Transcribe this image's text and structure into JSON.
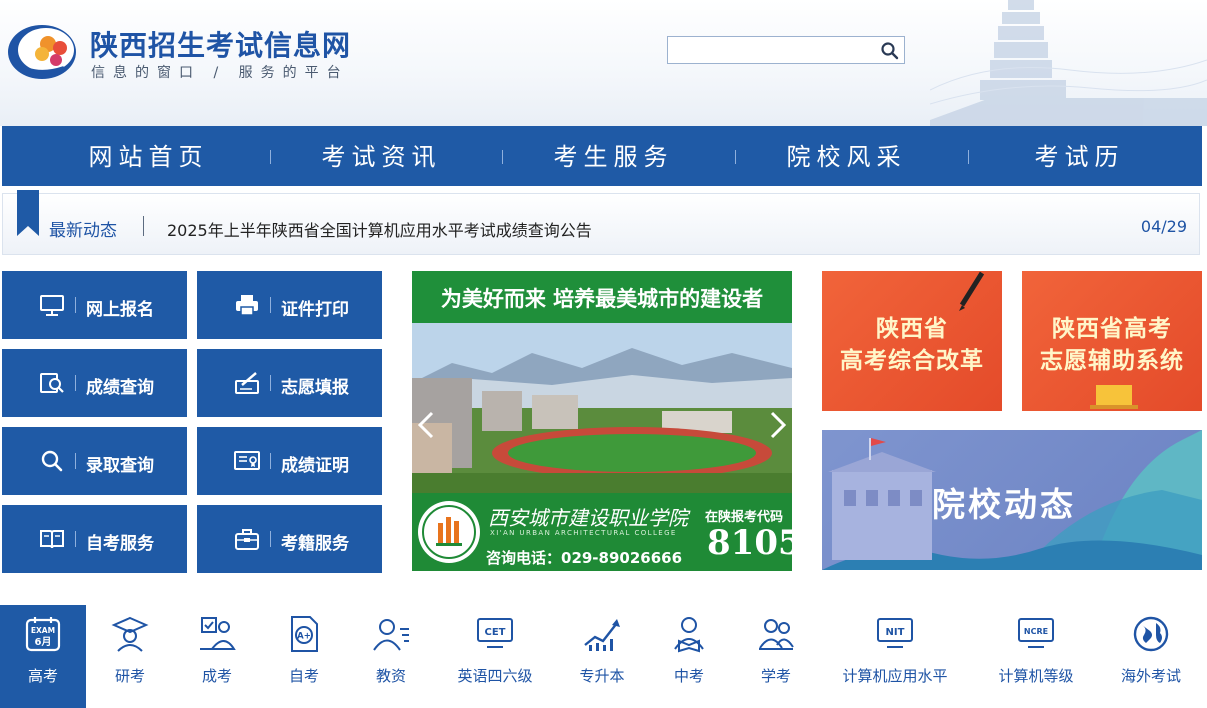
{
  "header": {
    "site_title": "陕西招生考试信息网",
    "slogan": "信息的窗口 / 服务的平台",
    "search_placeholder": ""
  },
  "nav": {
    "items": [
      "网站首页",
      "考试资讯",
      "考生服务",
      "院校风采",
      "考试历"
    ]
  },
  "news": {
    "label": "最新动态",
    "headline": "2025年上半年陕西省全国计算机应用水平考试成绩查询公告",
    "date": "04/29"
  },
  "services": [
    {
      "label": "网上报名",
      "icon": "monitor-icon"
    },
    {
      "label": "证件打印",
      "icon": "printer-icon"
    },
    {
      "label": "成绩查询",
      "icon": "score-search-icon"
    },
    {
      "label": "志愿填报",
      "icon": "form-fill-icon"
    },
    {
      "label": "录取查询",
      "icon": "search-icon"
    },
    {
      "label": "成绩证明",
      "icon": "certificate-icon"
    },
    {
      "label": "自考服务",
      "icon": "book-icon"
    },
    {
      "label": "考籍服务",
      "icon": "briefcase-icon"
    }
  ],
  "banner": {
    "headline": "为美好而来 培养最美城市的建设者",
    "college_name": "西安城市建设职业学院",
    "college_en": "XI'AN URBAN ARCHITECTURAL COLLEGE",
    "phone": "咨询电话：029-89026666",
    "code_label": "在陕报考代码",
    "code": "8105"
  },
  "promos": {
    "reform": [
      "陕西省",
      "高考综合改革"
    ],
    "volunteer": [
      "陕西省高考",
      "志愿辅助系统"
    ],
    "college_news": "院校动态"
  },
  "exams": [
    {
      "label": "高考",
      "icon": "exam-calendar-icon",
      "badge": "EXAM",
      "month": "6月",
      "active": true
    },
    {
      "label": "研考",
      "icon": "graduate-icon"
    },
    {
      "label": "成考",
      "icon": "adult-exam-icon"
    },
    {
      "label": "自考",
      "icon": "grade-doc-icon",
      "badge": "A+"
    },
    {
      "label": "教资",
      "icon": "teacher-icon"
    },
    {
      "label": "英语四六级",
      "icon": "cet-icon",
      "badge": "CET"
    },
    {
      "label": "专升本",
      "icon": "growth-chart-icon"
    },
    {
      "label": "中考",
      "icon": "student-icon"
    },
    {
      "label": "学考",
      "icon": "study-icon"
    },
    {
      "label": "计算机应用水平",
      "icon": "nit-icon",
      "badge": "NIT"
    },
    {
      "label": "计算机等级",
      "icon": "ncre-icon",
      "badge": "NCRE"
    },
    {
      "label": "海外考试",
      "icon": "globe-icon"
    }
  ],
  "colors": {
    "primary_blue": "#1f5aa6",
    "banner_green": "#1f8f3a",
    "promo_orange": "#e9552f"
  }
}
